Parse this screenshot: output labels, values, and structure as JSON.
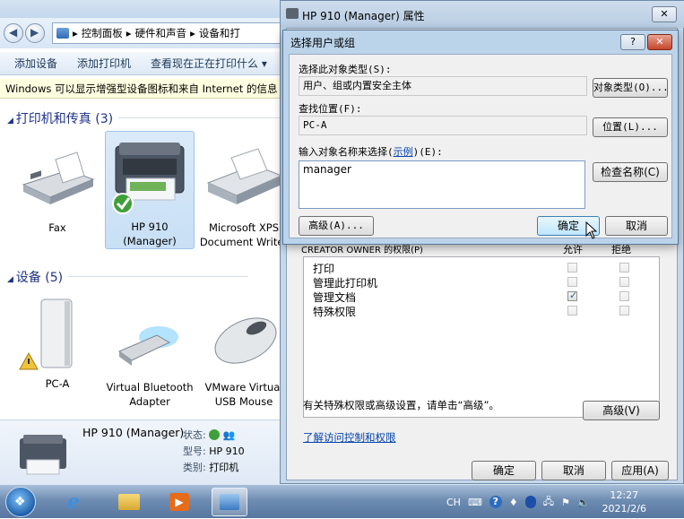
{
  "explorer": {
    "breadcrumb": [
      "控制面板",
      "硬件和声音",
      "设备和打"
    ],
    "toolbar": [
      "添加设备",
      "添加打印机",
      "查看现在正在打印什么 ▾"
    ],
    "infobar": "Windows 可以显示增强型设备图标和来自 Internet 的信息",
    "groups": {
      "printers_header": "打印机和传真 (3)",
      "devices_header": "设备 (5)"
    },
    "printers": [
      {
        "label": "Fax",
        "icon": "fax-icon"
      },
      {
        "label": "HP 910 (Manager)",
        "icon": "printer-icon"
      },
      {
        "label": "Microsoft XPS Document Writer",
        "icon": "xps-printer-icon"
      }
    ],
    "devices": [
      {
        "label": "PC-A",
        "icon": "computer-tower-icon"
      },
      {
        "label": "Virtual Bluetooth Adapter",
        "icon": "usb-bluetooth-icon"
      },
      {
        "label": "VMware Virtual USB Mouse",
        "icon": "mouse-icon"
      }
    ],
    "details": {
      "name": "HP 910 (Manager)",
      "status_label": "状态:",
      "model_label": "型号:",
      "model_value": "HP 910",
      "category_label": "类别:",
      "category_value": "打印机"
    }
  },
  "properties": {
    "title": "HP 910 (Manager) 属性",
    "perm_header": "CREATOR OWNER 的权限(P)",
    "allow_header": "允许",
    "deny_header": "拒绝",
    "permissions": [
      {
        "name": "打印",
        "allow": false,
        "deny": false
      },
      {
        "name": "管理此打印机",
        "allow": false,
        "deny": false
      },
      {
        "name": "管理文档",
        "allow": true,
        "deny": false
      },
      {
        "name": "特殊权限",
        "allow": false,
        "deny": false
      }
    ],
    "advanced_note": "有关特殊权限或高级设置，请单击“高级”。",
    "advanced_button": "高级(V)",
    "learn_link": "了解访问控制和权限",
    "ok": "确定",
    "cancel": "取消",
    "apply": "应用(A)"
  },
  "select_dialog": {
    "title": "选择用户或组",
    "object_type_label": "选择此对象类型(S):",
    "object_type_value": "用户、组或内置安全主体",
    "object_type_button": "对象类型(O)...",
    "location_label": "查找位置(F):",
    "location_value": "PC-A",
    "location_button": "位置(L)...",
    "enter_label_pre": "输入对象名称来选择(",
    "enter_label_link": "示例",
    "enter_label_post": ")(E):",
    "enter_value": "manager",
    "check_names_button": "检查名称(C)",
    "advanced_button": "高级(A)...",
    "ok": "确定",
    "cancel": "取消",
    "help": "?"
  },
  "taskbar": {
    "lang": "CH",
    "time": "12:27",
    "date": "2021/2/6"
  }
}
